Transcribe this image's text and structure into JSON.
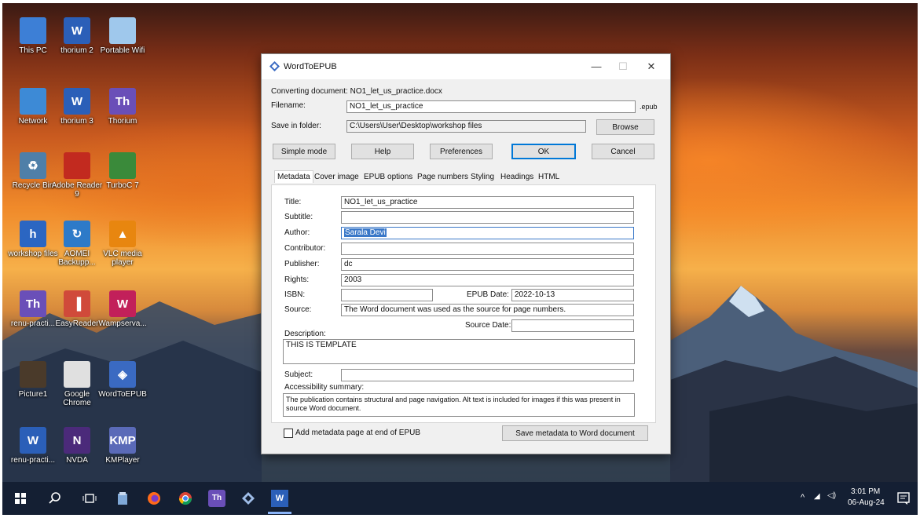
{
  "desktop_icons": [
    {
      "name": "this-pc",
      "label": "This PC",
      "glyph": "",
      "color": "#3d7fd6"
    },
    {
      "name": "thorium2-doc",
      "label": "thorium 2",
      "glyph": "W",
      "color": "#2b5fb8"
    },
    {
      "name": "portable-wifi",
      "label": "Portable Wifi",
      "glyph": "",
      "color": "#9fc8ec"
    },
    {
      "name": "network",
      "label": "Network",
      "glyph": "",
      "color": "#3d8ad6"
    },
    {
      "name": "thorium3-doc",
      "label": "thorium 3",
      "glyph": "W",
      "color": "#2b5fb8"
    },
    {
      "name": "thorium-app",
      "label": "Thorium",
      "glyph": "Th",
      "color": "#6a4fb8"
    },
    {
      "name": "recycle-bin",
      "label": "Recycle Bin",
      "glyph": "♻",
      "color": "#4f7fa8"
    },
    {
      "name": "adobe-reader",
      "label": "Adobe Reader 9",
      "glyph": "",
      "color": "#c22a1f"
    },
    {
      "name": "turboc",
      "label": "TurboC 7",
      "glyph": "",
      "color": "#3a8a3a"
    },
    {
      "name": "workshop-files",
      "label": "workshop files",
      "glyph": "h",
      "color": "#2b66c2"
    },
    {
      "name": "aomei-backup",
      "label": "AOMEI Backupp...",
      "glyph": "↻",
      "color": "#2d7ac8"
    },
    {
      "name": "vlc",
      "label": "VLC media player",
      "glyph": "▲",
      "color": "#e8860f"
    },
    {
      "name": "renu-practice-th",
      "label": "renu-practi...",
      "glyph": "Th",
      "color": "#6a4fb8"
    },
    {
      "name": "easyreader",
      "label": "EasyReader",
      "glyph": "▐",
      "color": "#d04a3a"
    },
    {
      "name": "wampserver",
      "label": "Wampserva...",
      "glyph": "W",
      "color": "#c2205a"
    },
    {
      "name": "picture1",
      "label": "Picture1",
      "glyph": "",
      "color": "#4a3a2a"
    },
    {
      "name": "google-chrome",
      "label": "Google Chrome",
      "glyph": "",
      "color": "#e0e0e0"
    },
    {
      "name": "wordtoepub",
      "label": "WordToEPUB",
      "glyph": "◈",
      "color": "#3a6ac2"
    },
    {
      "name": "renu-practice-doc",
      "label": "renu-practi...",
      "glyph": "W",
      "color": "#2b5fb8"
    },
    {
      "name": "nvda",
      "label": "NVDA",
      "glyph": "N",
      "color": "#4b2a7a"
    },
    {
      "name": "kmplayer",
      "label": "KMPlayer",
      "glyph": "KMP",
      "color": "#5a6ab8"
    }
  ],
  "window": {
    "title": "WordToEPUB",
    "converting": "Converting document: NO1_let_us_practice.docx",
    "filename_label": "Filename:",
    "filename_value": "NO1_let_us_practice",
    "extension": ".epub",
    "save_label": "Save in folder:",
    "save_value": "C:\\Users\\User\\Desktop\\workshop files",
    "browse": "Browse",
    "buttons": {
      "simple": "Simple mode",
      "help": "Help",
      "preferences": "Preferences",
      "ok": "OK",
      "cancel": "Cancel"
    },
    "tabs": [
      "Metadata",
      "Cover image",
      "EPUB options",
      "Page numbers",
      "Styling",
      "Headings",
      "HTML"
    ],
    "meta": {
      "title_label": "Title:",
      "title_value": "NO1_let_us_practice",
      "subtitle_label": "Subtitle:",
      "subtitle_value": "",
      "author_label": "Author:",
      "author_value": "Sarala Devi",
      "contributor_label": "Contributor:",
      "contributor_value": "",
      "publisher_label": "Publisher:",
      "publisher_value": "dc",
      "rights_label": "Rights:",
      "rights_value": "2003",
      "isbn_label": "ISBN:",
      "isbn_value": "",
      "epubdate_label": "EPUB Date:",
      "epubdate_value": "2022-10-13",
      "source_label": "Source:",
      "source_value": "The Word document was used as the source for page numbers.",
      "sourcedate_label": "Source Date:",
      "sourcedate_value": "",
      "description_label": "Description:",
      "description_value": "THIS IS TEMPLATE",
      "subject_label": "Subject:",
      "subject_value": "",
      "accessibility_label": "Accessibility summary:",
      "accessibility_value": "The publication contains structural and page navigation. Alt text is included for images if this was present in source Word document."
    },
    "checkbox_label": "Add metadata page at end of EPUB",
    "save_meta_button": "Save metadata to Word document"
  },
  "tray": {
    "time": "3:01 PM",
    "date": "06-Aug-24"
  }
}
